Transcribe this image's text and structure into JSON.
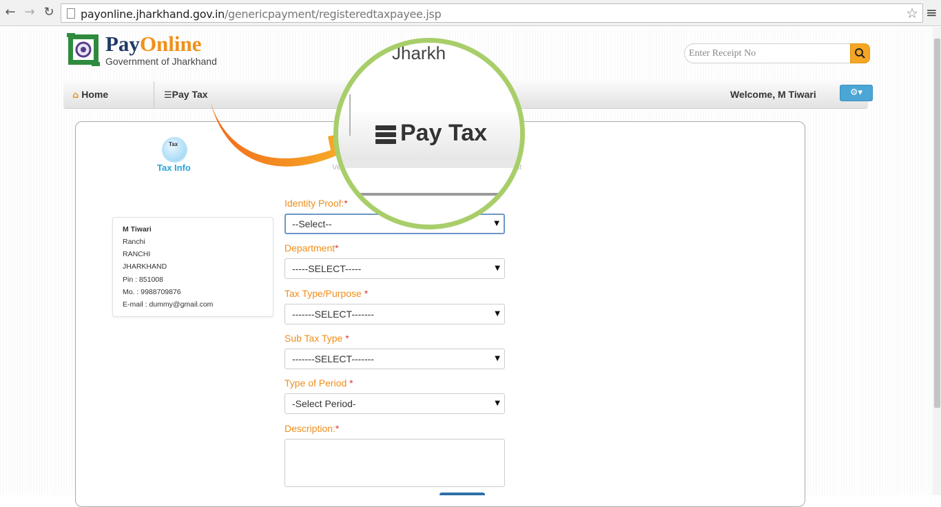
{
  "browser": {
    "url_host": "payonline.jharkhand.gov.in",
    "url_path": "/genericpayment/registeredtaxpayee.jsp",
    "back_icon": "back-arrow-icon",
    "forward_icon": "forward-arrow-icon",
    "reload_icon": "reload-icon",
    "bookmark_icon": "star-icon",
    "menu_icon": "hamburger-menu-icon"
  },
  "header": {
    "logo_pay": "Pay",
    "logo_online": "Online",
    "logo_subtitle": "Government of Jharkhand",
    "receipt_placeholder": "Enter Receipt No",
    "search_icon": "search-icon"
  },
  "navbar": {
    "home_label": "Home",
    "pay_tax_label": "Pay Tax",
    "welcome_text": "Welcome, M Tiwari",
    "settings_icon": "gear-icon"
  },
  "steps": {
    "tax_info_label": "Tax Info",
    "tax_info_icon_text": "Tax",
    "step2_fragment": "Ver",
    "step3_fragment": "nent"
  },
  "user_card": {
    "name": "M Tiwari",
    "city": "Ranchi",
    "district": "RANCHI",
    "state": "JHARKHAND",
    "pin": "Pin : 851008",
    "mobile": "Mo. : 9988709876",
    "email": "E-mail : dummy@gmail.com"
  },
  "form": {
    "identity_proof": {
      "label": "Identity Proof:",
      "req": "*",
      "value": "--Select--"
    },
    "department": {
      "label": "Department",
      "req": "*",
      "value": "-----SELECT-----"
    },
    "tax_type": {
      "label": "Tax Type/Purpose ",
      "req": "*",
      "value": "-------SELECT-------"
    },
    "sub_tax_type": {
      "label": "Sub Tax Type ",
      "req": "*",
      "value": "-------SELECT-------"
    },
    "period_type": {
      "label": "Type of Period ",
      "req": "*",
      "value": "-Select Period-"
    },
    "description": {
      "label": "Description:",
      "req": "*"
    }
  },
  "callout": {
    "zoom_label": "Pay Tax",
    "zoom_top_fragment": "Jharkh",
    "circle_color": "#a8ce6a",
    "arrow_color": "#f5a623"
  },
  "colors": {
    "accent_orange": "#ef8d1a",
    "accent_blue": "#2aa3d6",
    "brand_navy": "#1f3a66"
  }
}
